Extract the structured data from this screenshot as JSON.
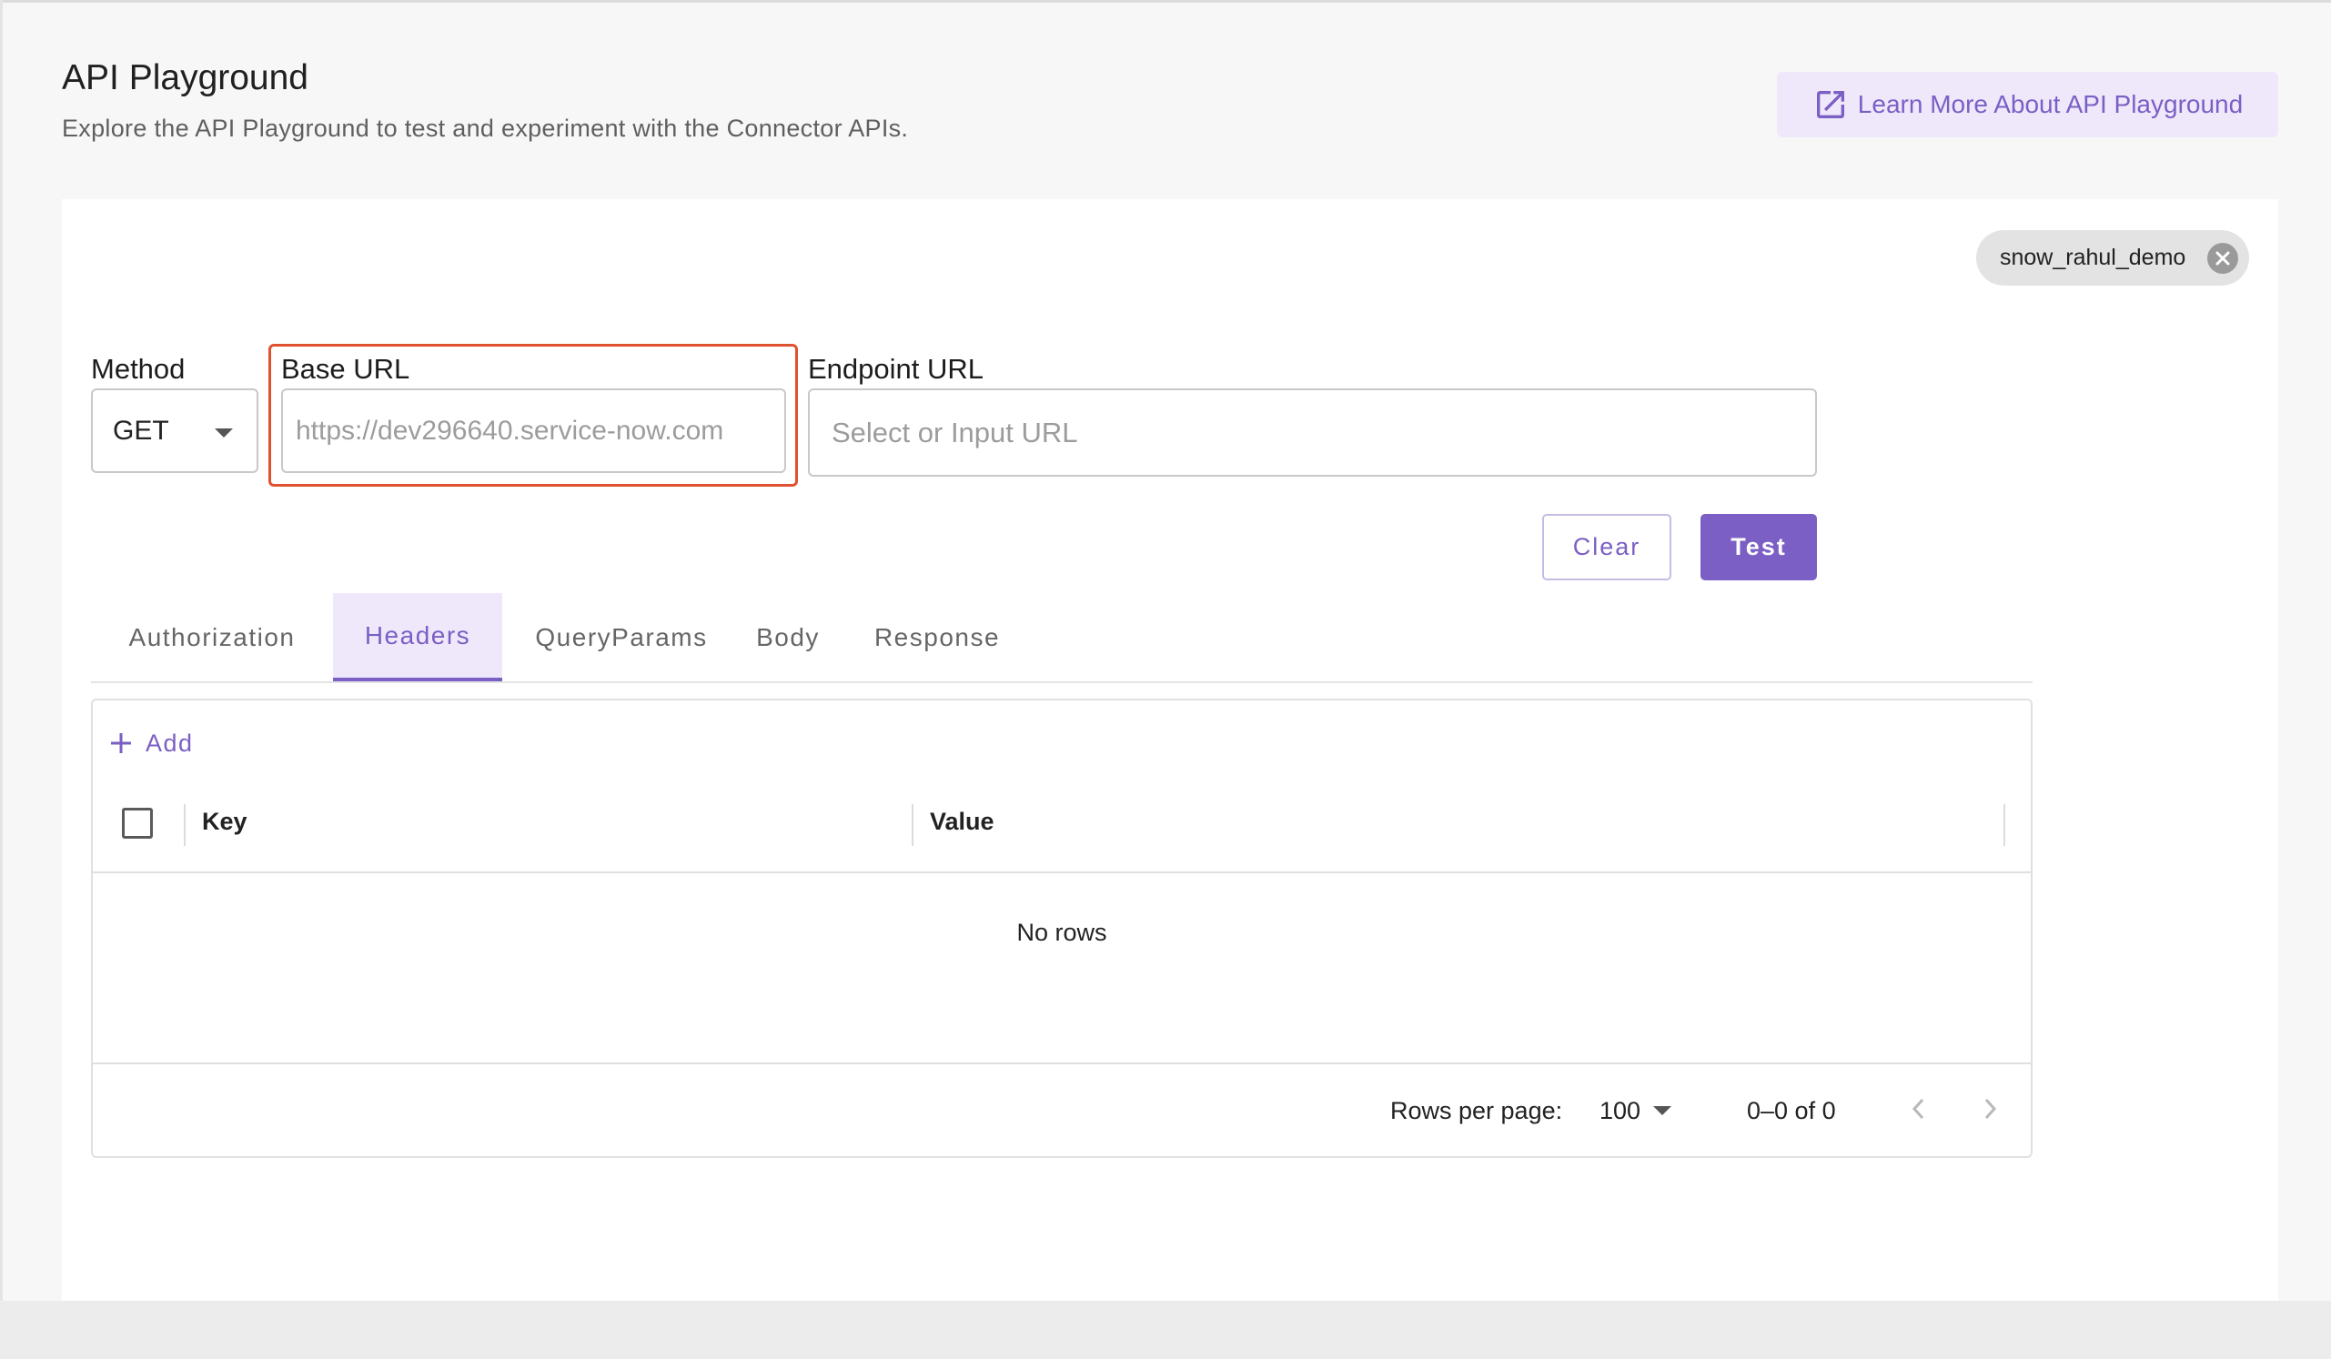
{
  "header": {
    "title": "API Playground",
    "subtitle": "Explore the API Playground to test and experiment with the Connector APIs.",
    "learn_more_label": "Learn More About API Playground"
  },
  "connection_chip": {
    "label": "snow_rahul_demo"
  },
  "form": {
    "method_label": "Method",
    "method_value": "GET",
    "base_url_label": "Base URL",
    "base_url_placeholder": "https://dev296640.service-now.com",
    "endpoint_label": "Endpoint URL",
    "endpoint_placeholder": "Select or Input URL",
    "clear_label": "Clear",
    "test_label": "Test"
  },
  "tabs": [
    {
      "label": "Authorization",
      "active": false
    },
    {
      "label": "Headers",
      "active": true
    },
    {
      "label": "QueryParams",
      "active": false
    },
    {
      "label": "Body",
      "active": false
    },
    {
      "label": "Response",
      "active": false
    }
  ],
  "grid": {
    "add_label": "Add",
    "columns": [
      "Key",
      "Value"
    ],
    "empty_text": "No rows",
    "rows_per_page_label": "Rows per page:",
    "rows_per_page_value": "100",
    "range_text": "0–0 of 0"
  },
  "colors": {
    "accent": "#7b5fc4",
    "accent_light": "#efe8fb",
    "highlight": "#e0512f"
  }
}
